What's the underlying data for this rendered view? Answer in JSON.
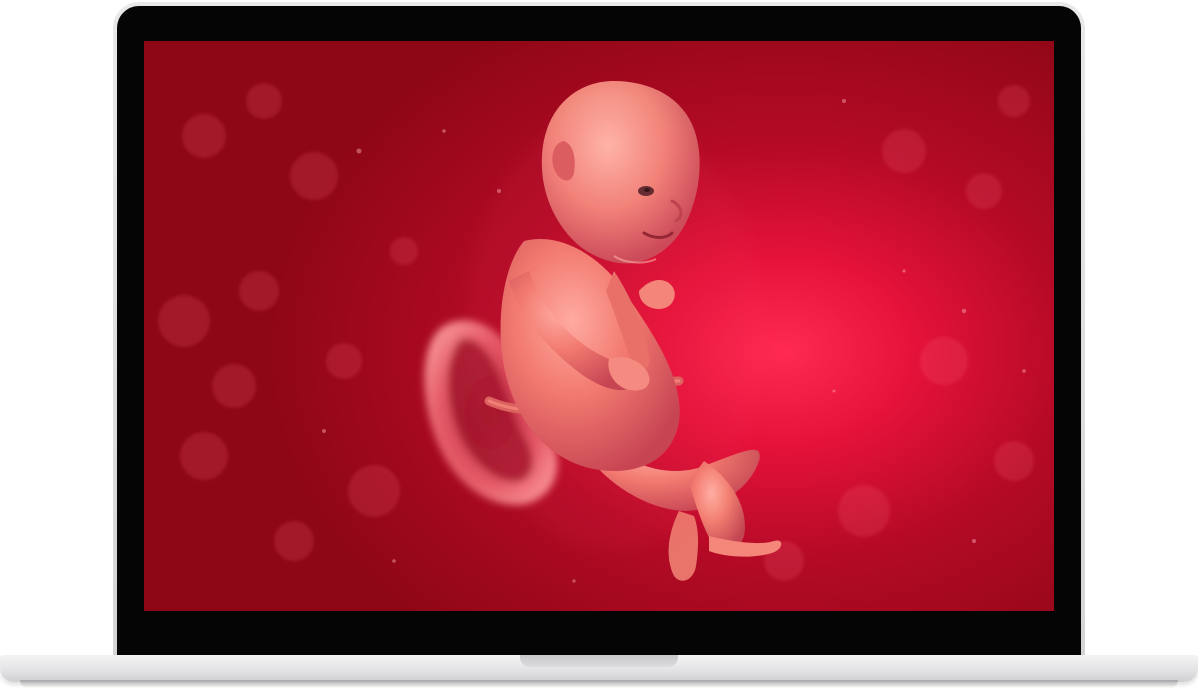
{
  "device": {
    "type": "laptop",
    "frame_color": "#d9d9db",
    "bezel_color": "#050505"
  },
  "screen_image": {
    "subject": "fetus-illustration",
    "background_color": "#c20b2c",
    "glow_color": "#ff2a52",
    "skin_color": "#f07a6e"
  }
}
